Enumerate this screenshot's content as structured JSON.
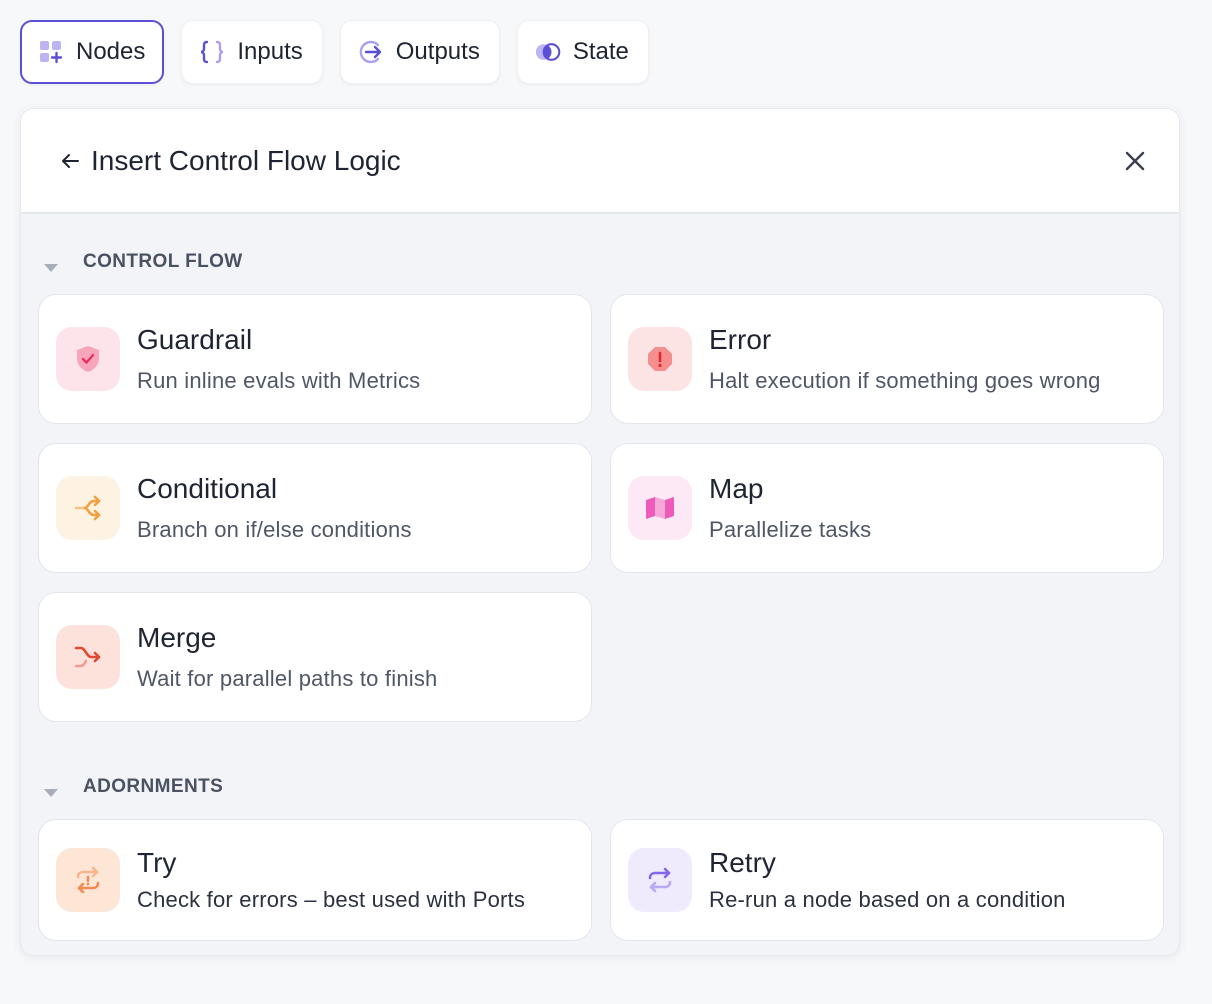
{
  "tabs": [
    {
      "label": "Nodes",
      "icon": "nodes-add-icon",
      "active": true
    },
    {
      "label": "Inputs",
      "icon": "braces-icon",
      "active": false
    },
    {
      "label": "Outputs",
      "icon": "arrow-right-circle-icon",
      "active": false
    },
    {
      "label": "State",
      "icon": "state-circles-icon",
      "active": false
    }
  ],
  "panel": {
    "title": "Insert Control Flow Logic"
  },
  "sections": [
    {
      "title": "CONTROL FLOW",
      "items": [
        {
          "title": "Guardrail",
          "description": "Run inline evals with Metrics",
          "icon": "shield-check-icon",
          "color": "#f0557d",
          "bg": "#fde3ea"
        },
        {
          "title": "Error",
          "description": "Halt execution if something goes wrong",
          "icon": "octagon-alert-icon",
          "color": "#ef5350",
          "bg": "#fde4e4"
        },
        {
          "title": "Conditional",
          "description": "Branch on if/else conditions",
          "icon": "branch-icon",
          "color": "#f3a64a",
          "bg": "#fef3e2"
        },
        {
          "title": "Map",
          "description": "Parallelize tasks",
          "icon": "map-icon",
          "color": "#e94fb1",
          "bg": "#fde9f5"
        },
        {
          "title": "Merge",
          "description": "Wait for parallel paths to finish",
          "icon": "merge-icon",
          "color": "#e0503a",
          "bg": "#fde2dc"
        }
      ]
    },
    {
      "title": "ADORNMENTS",
      "items": [
        {
          "title": "Try",
          "description": "Check for errors – best used with Ports",
          "icon": "try-repeat-alert-icon",
          "color": "#f59b6a",
          "bg": "#fee6d6"
        },
        {
          "title": "Retry",
          "description": "Re-run a node based on a condition",
          "icon": "retry-icon",
          "color": "#8b6ff0",
          "bg": "#efebfd"
        }
      ]
    }
  ]
}
